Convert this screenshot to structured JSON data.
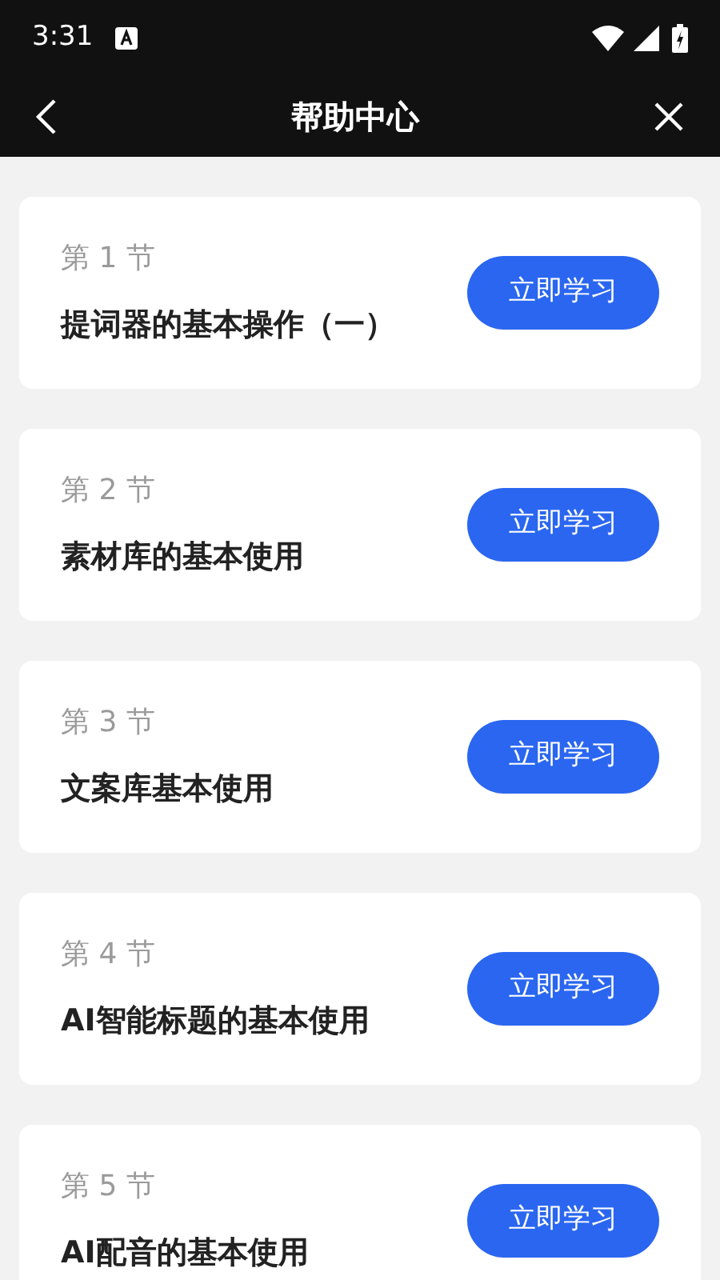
{
  "status_bar": {
    "time": "3:31"
  },
  "header": {
    "title": "帮助中心"
  },
  "lessons": [
    {
      "section": "第 1 节",
      "title": "提词器的基本操作（一）",
      "button": "立即学习"
    },
    {
      "section": "第 2 节",
      "title": "素材库的基本使用",
      "button": "立即学习"
    },
    {
      "section": "第 3 节",
      "title": "文案库基本使用",
      "button": "立即学习"
    },
    {
      "section": "第 4 节",
      "title": "AI智能标题的基本使用",
      "button": "立即学习"
    },
    {
      "section": "第 5 节",
      "title": "AI配音的基本使用",
      "button": "立即学习"
    }
  ]
}
